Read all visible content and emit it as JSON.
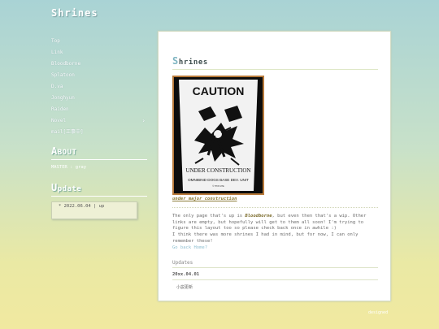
{
  "site": {
    "title": "Shrines"
  },
  "sidebar": {
    "items": [
      {
        "label": "Top"
      },
      {
        "label": "Link"
      },
      {
        "label": "Bloodborne"
      },
      {
        "label": "Splatoon"
      },
      {
        "label": "D.va"
      },
      {
        "label": "Jonghyun"
      },
      {
        "label": "Raiden"
      },
      {
        "label": "Novel"
      },
      {
        "label": "mail[工事中]"
      }
    ],
    "about": {
      "head_first": "A",
      "head_rest": "BOUT",
      "text": "MASTER : gray"
    },
    "update": {
      "head_first": "U",
      "head_rest": "pdate",
      "entry": "* 2022.06.04 | up"
    }
  },
  "main": {
    "title_first": "S",
    "title_rest": "hrines",
    "sign": {
      "heading": "CAUTION",
      "line1": "UNDER CONSTRUCTION",
      "line2": "OMNIBIND DOGS BASE DEV. UNIT",
      "line3": "© THIS SITE"
    },
    "caption": "under major construction",
    "paragraph_pre": "The only page that's up is ",
    "paragraph_link": "Bloodborne",
    "paragraph_post": ", but even then that's a wip. Other links are empty, but hopefully will get to them all soon! I'm trying to figure this layout too so please check back once in awhile :)",
    "paragraph2": "I think there was more shrines I had in mind, but for now, I can only remember these!",
    "go_back": "Go back Home?",
    "updates_head": "Updates",
    "update_date": "20xx.04.01",
    "update_entry": "小説更新"
  },
  "footer": {
    "text": "designed"
  },
  "colors": {
    "accent": "#7fb5c2",
    "link": "#7a6a2a",
    "bg_top": "#a9d3d5",
    "bg_bottom": "#f1e9a0"
  }
}
